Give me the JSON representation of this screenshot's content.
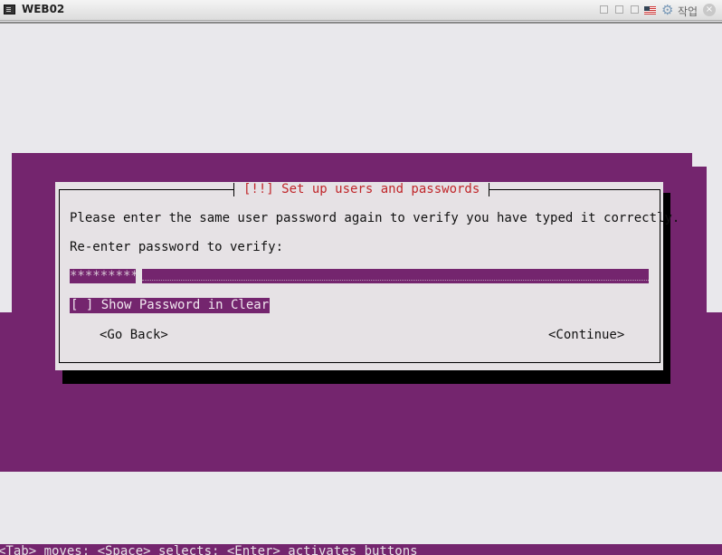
{
  "window": {
    "title": "WEB02",
    "action_label": "작업",
    "close_symbol": "×"
  },
  "dialog": {
    "title": "[!!] Set up users and passwords",
    "instruction": "Please enter the same user password again to verify you have typed it correctly.",
    "prompt": "Re-enter password to verify:",
    "password_value": "*********",
    "show_password_label": "[ ] Show Password in Clear",
    "go_back_label": "<Go Back>",
    "continue_label": "<Continue>"
  },
  "status_bar": {
    "text": "<Tab> moves; <Space> selects; <Enter> activates buttons"
  },
  "colors": {
    "installer_purple": "#74256e",
    "dialog_bg": "#e6e2e5",
    "title_red": "#c0262a"
  }
}
